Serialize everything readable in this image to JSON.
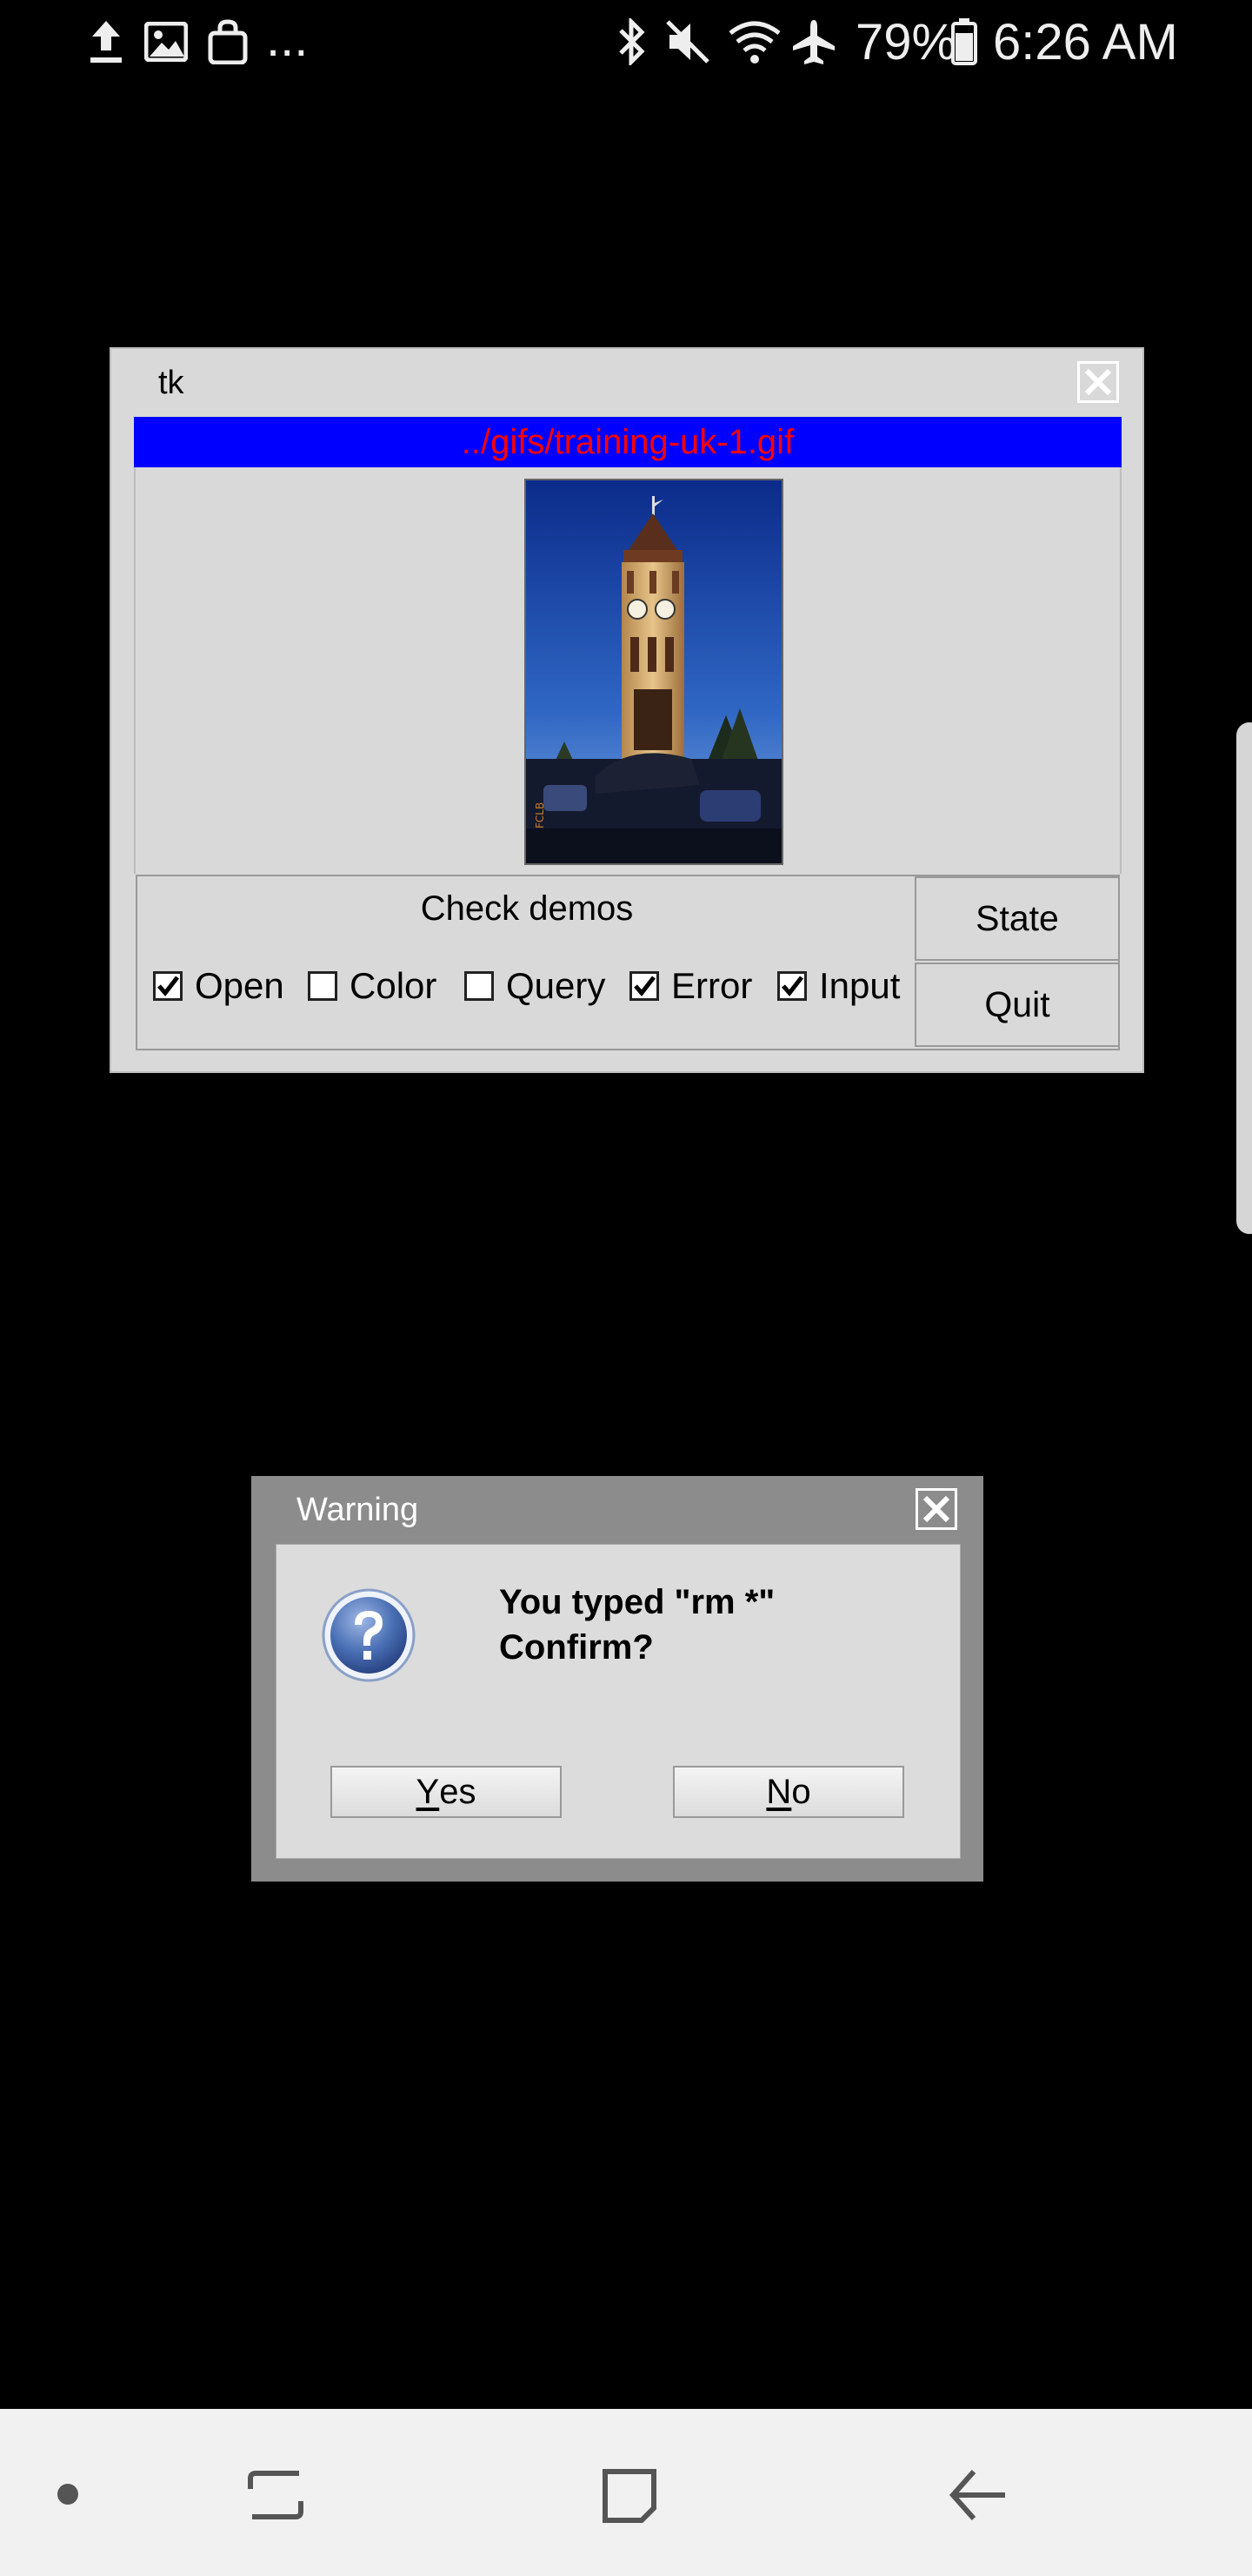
{
  "status_bar": {
    "left_icons": [
      "upload-icon",
      "image-icon",
      "shopping-bag-icon"
    ],
    "more": "...",
    "right_icons": [
      "bluetooth-icon",
      "mute-icon",
      "wifi-icon",
      "airplane-icon"
    ],
    "battery_percent": "79%",
    "time": "6:26 AM",
    "battery_level": 0.79
  },
  "tk_window": {
    "title": "tk",
    "filename": "../gifs/training-uk-1.gif",
    "filename_colors": {
      "background": "#0000ff",
      "text": "#ff0000"
    },
    "check_demos_label": "Check demos",
    "checkboxes": [
      {
        "label": "Open",
        "checked": true
      },
      {
        "label": "Color",
        "checked": false
      },
      {
        "label": "Query",
        "checked": false
      },
      {
        "label": "Error",
        "checked": true
      },
      {
        "label": "Input",
        "checked": true
      }
    ],
    "state_button": "State",
    "quit_button": "Quit"
  },
  "warning_dialog": {
    "title": "Warning",
    "message_line1": "You typed \"rm *\"",
    "message_line2": "Confirm?",
    "yes_first": "Y",
    "yes_rest": "es",
    "no_first": "N",
    "no_rest": "o"
  },
  "nav_bar": {
    "icons": [
      "dot-icon",
      "recent-apps-icon",
      "home-icon",
      "back-icon"
    ]
  }
}
